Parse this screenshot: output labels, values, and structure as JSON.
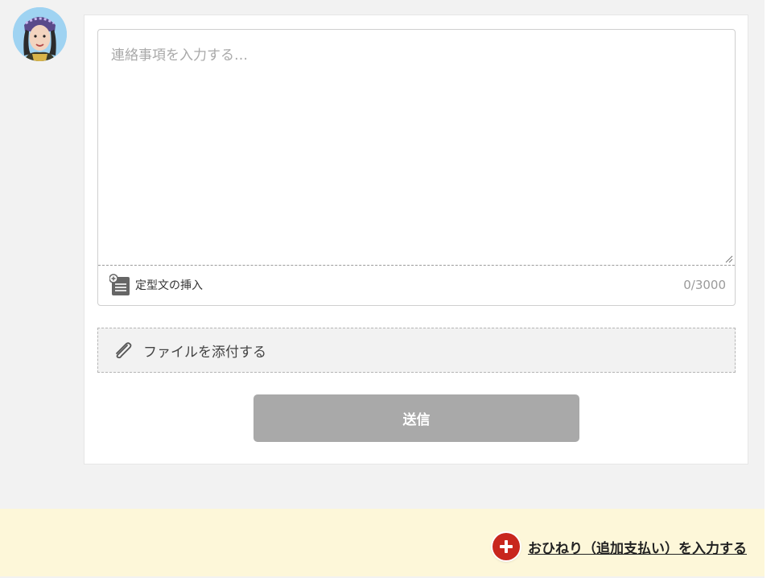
{
  "message": {
    "placeholder": "連絡事項を入力する…",
    "char_count": "0/3000",
    "template_insert_label": "定型文の挿入"
  },
  "attachment": {
    "label": "ファイルを添付する"
  },
  "send": {
    "label": "送信"
  },
  "tip": {
    "label": "おひねり（追加支払い）を入力する"
  },
  "icons": {
    "avatar": "user-avatar",
    "template": "template-insert-icon",
    "attach": "paperclip-icon",
    "tip": "plus-circle-icon"
  },
  "colors": {
    "send_disabled": "#a9a9a9",
    "tip_bar_bg": "#fdf7d9",
    "tip_icon": "#c8261d"
  }
}
